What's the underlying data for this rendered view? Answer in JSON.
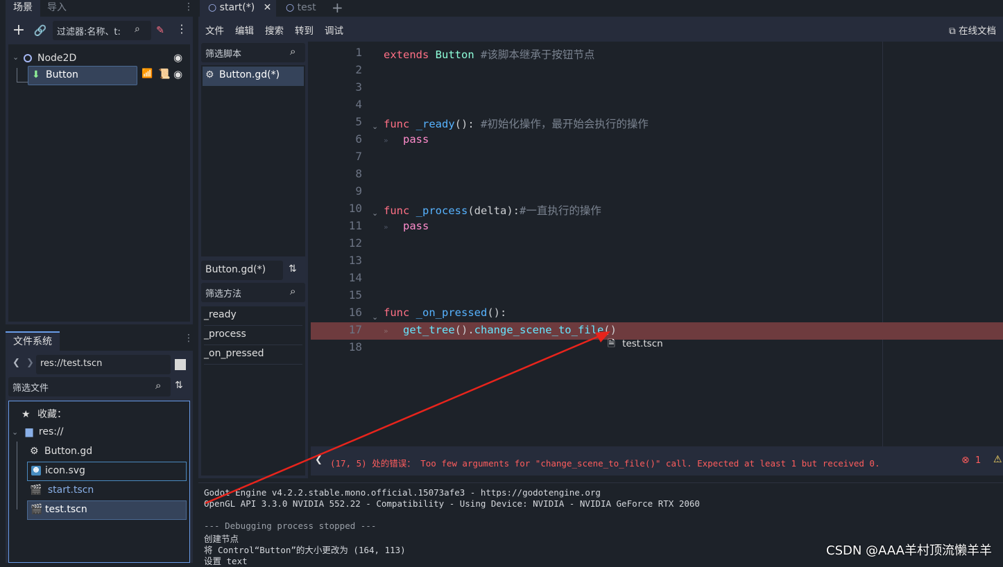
{
  "scene_panel": {
    "tabs": [
      "场景",
      "导入"
    ],
    "filter_placeholder": "过滤器:名称、t:",
    "tree": [
      {
        "label": "Node2D"
      },
      {
        "label": "Button"
      }
    ]
  },
  "filesystem": {
    "tab": "文件系统",
    "path": "res://test.tscn",
    "filter_placeholder": "筛选文件",
    "favorites": "收藏：",
    "root": "res://",
    "files": [
      "Button.gd",
      "icon.svg",
      "start.tscn",
      "test.tscn"
    ]
  },
  "editor_tabs": [
    "start(*)",
    "test"
  ],
  "menu": [
    "文件",
    "编辑",
    "搜索",
    "转到",
    "调试"
  ],
  "online_docs": "在线文档",
  "script_list": {
    "filter_placeholder": "筛选脚本",
    "items": [
      "Button.gd(*)"
    ],
    "current": "Button.gd(*)",
    "method_filter_placeholder": "筛选方法",
    "methods": [
      "_ready",
      "_process",
      "_on_pressed"
    ]
  },
  "code": {
    "line_numbers": [
      "1",
      "2",
      "3",
      "4",
      "5",
      "6",
      "7",
      "8",
      "9",
      "10",
      "11",
      "12",
      "13",
      "14",
      "15",
      "16",
      "17",
      "18"
    ],
    "lines": [
      {
        "l": 1,
        "t": [
          [
            "kw",
            "extends "
          ],
          [
            "cls",
            "Button "
          ],
          [
            "cm",
            "#该脚本继承于按钮节点"
          ]
        ]
      },
      {
        "l": 5,
        "t": [
          [
            "kw",
            "func "
          ],
          [
            "fn",
            "_ready"
          ],
          [
            "pl",
            "(): "
          ],
          [
            "cm",
            "#初始化操作，最开始会执行的操作"
          ]
        ]
      },
      {
        "l": 6,
        "t": [
          [
            "kw2",
            "   pass"
          ]
        ]
      },
      {
        "l": 10,
        "t": [
          [
            "kw",
            "func "
          ],
          [
            "fn",
            "_process"
          ],
          [
            "pl",
            "(delta):"
          ],
          [
            "cm",
            "#一直执行的操作"
          ]
        ]
      },
      {
        "l": 11,
        "t": [
          [
            "kw2",
            "   pass"
          ]
        ]
      },
      {
        "l": 16,
        "t": [
          [
            "kw",
            "func "
          ],
          [
            "fn",
            "_on_pressed"
          ],
          [
            "pl",
            "():"
          ]
        ]
      },
      {
        "l": 17,
        "t": [
          [
            "fn2",
            "   get_tree"
          ],
          [
            "pl",
            "()."
          ],
          [
            "fn2",
            "change_scene_to_file"
          ],
          [
            "pl",
            "()"
          ]
        ]
      }
    ],
    "autocomplete": "test.tscn"
  },
  "error_bar": {
    "message": "(17, 5) 处的错误： Too few arguments for \"change_scene_to_file()\" call. Expected at least 1 but received 0.",
    "error_count": "1"
  },
  "console": [
    "Godot Engine v4.2.2.stable.mono.official.15073afe3 - https://godotengine.org",
    "OpenGL API 3.3.0 NVIDIA 552.22 - Compatibility - Using Device: NVIDIA - NVIDIA GeForce RTX 2060",
    "",
    "--- Debugging process stopped ---",
    "创建节点",
    "将 Control“Button”的大小更改为 (164, 113)",
    "设置 text"
  ],
  "watermark": "CSDN @AAA羊村顶流懒羊羊",
  "colors": {
    "accent": "#699ce8",
    "error": "#ff5d5d",
    "highlight_line": "#6e3b3e"
  }
}
